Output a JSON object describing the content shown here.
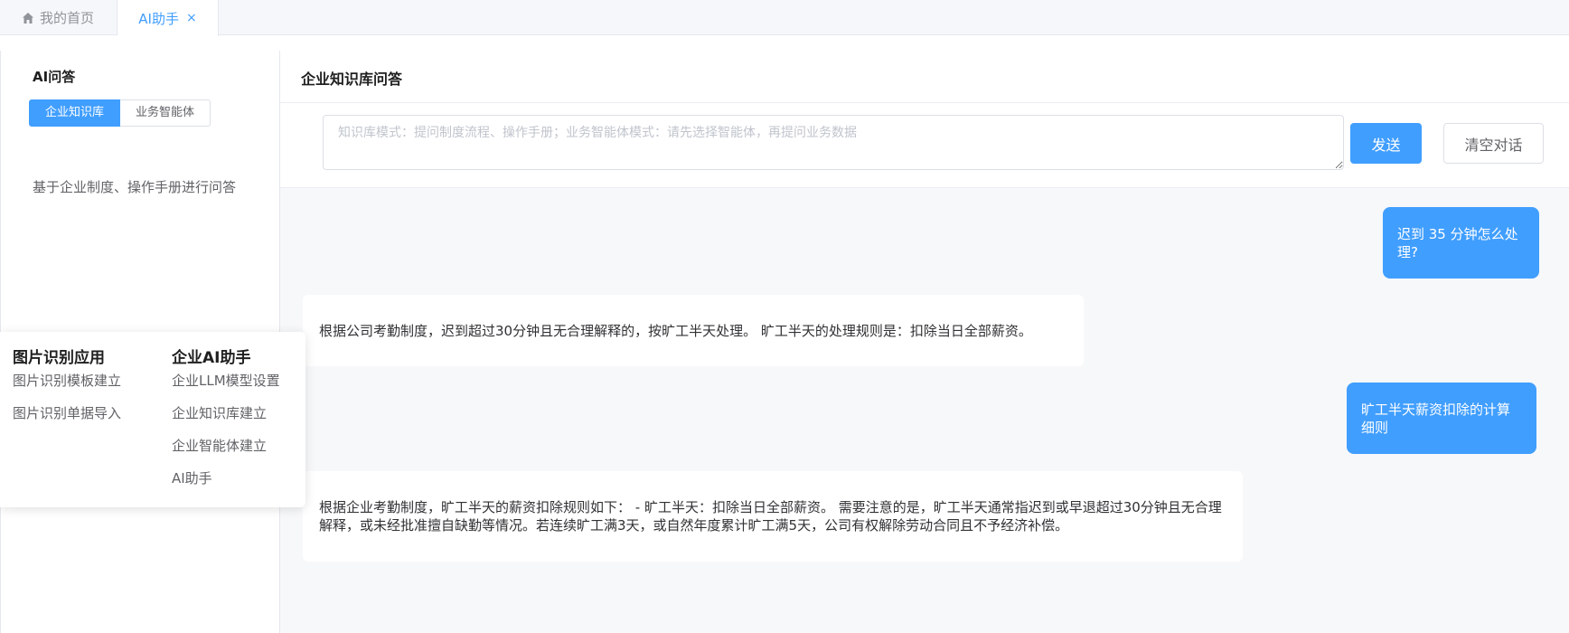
{
  "tabs": {
    "home_label": "我的首页",
    "active_label": "AI助手",
    "close_glyph": "×"
  },
  "sidebar": {
    "title": "AI问答",
    "modes": [
      "企业知识库",
      "业务智能体"
    ],
    "description": "基于企业制度、操作手册进行问答"
  },
  "main": {
    "title": "企业知识库问答",
    "input_placeholder": "知识库模式：提问制度流程、操作手册；业务智能体模式：请先选择智能体，再提问业务数据",
    "send_label": "发送",
    "clear_label": "清空对话"
  },
  "messages": [
    {
      "role": "user",
      "text": "迟到 35 分钟怎么处理?"
    },
    {
      "role": "assistant",
      "text": "根据公司考勤制度，迟到超过30分钟且无合理解释的，按旷工半天处理。 旷工半天的处理规则是：扣除当日全部薪资。"
    },
    {
      "role": "user",
      "text": "旷工半天薪资扣除的计算细则"
    },
    {
      "role": "assistant",
      "text": "根据企业考勤制度，旷工半天的薪资扣除规则如下： - 旷工半天：扣除当日全部薪资。 需要注意的是，旷工半天通常指迟到或早退超过30分钟且无合理解释，或未经批准擅自缺勤等情况。若连续旷工满3天，或自然年度累计旷工满5天，公司有权解除劳动合同且不予经济补偿。"
    }
  ],
  "popup_menu": {
    "col1": {
      "title": "图片识别应用",
      "items": [
        "图片识别模板建立",
        "图片识别单据导入"
      ]
    },
    "col2": {
      "title": "企业AI助手",
      "items": [
        "企业LLM模型设置",
        "企业知识库建立",
        "企业智能体建立",
        "AI助手"
      ]
    }
  },
  "colors": {
    "accent": "#409eff",
    "background": "#f7f8fa"
  },
  "icons": {
    "home": "home-icon",
    "close": "close-icon"
  }
}
